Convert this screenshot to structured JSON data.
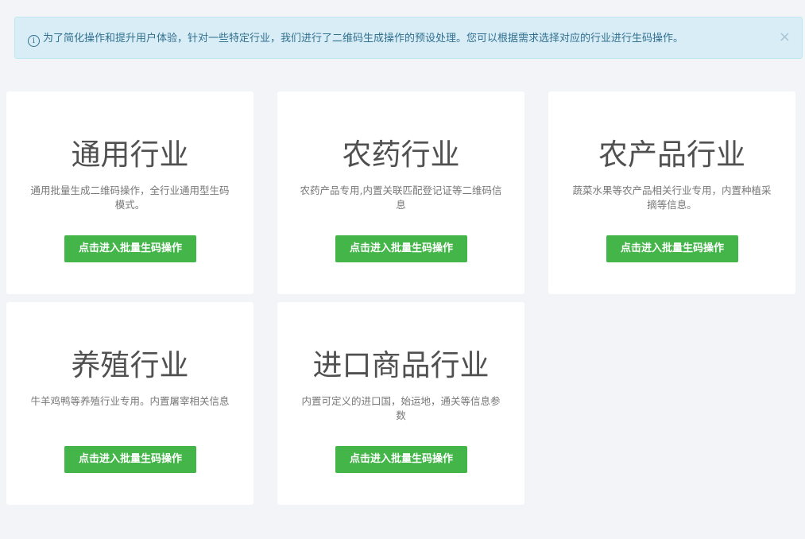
{
  "notice": {
    "icon": "info-icon",
    "icon_glyph": "i",
    "text": "为了简化操作和提升用户体验，针对一些特定行业，我们进行了二维码生成操作的预设处理。您可以根据需求选择对应的行业进行生码操作。",
    "close_glyph": "×",
    "colors": {
      "background": "#d9edf7",
      "text": "#31708f"
    }
  },
  "cards": [
    {
      "title": "通用行业",
      "desc": "通用批量生成二维码操作，全行业通用型生码模式。",
      "button": "点击进入批量生码操作"
    },
    {
      "title": "农药行业",
      "desc": "农药产品专用,内置关联匹配登记证等二维码信息",
      "button": "点击进入批量生码操作"
    },
    {
      "title": "农产品行业",
      "desc": "蔬菜水果等农产品相关行业专用，内置种植采摘等信息。",
      "button": "点击进入批量生码操作"
    },
    {
      "title": "养殖行业",
      "desc": "牛羊鸡鸭等养殖行业专用。内置屠宰相关信息",
      "button": "点击进入批量生码操作"
    },
    {
      "title": "进口商品行业",
      "desc": "内置可定义的进口国，始运地，通关等信息参数",
      "button": "点击进入批量生码操作"
    }
  ],
  "colors": {
    "button": "#44b549",
    "page_background": "#f3f4f8",
    "card_background": "#ffffff"
  }
}
